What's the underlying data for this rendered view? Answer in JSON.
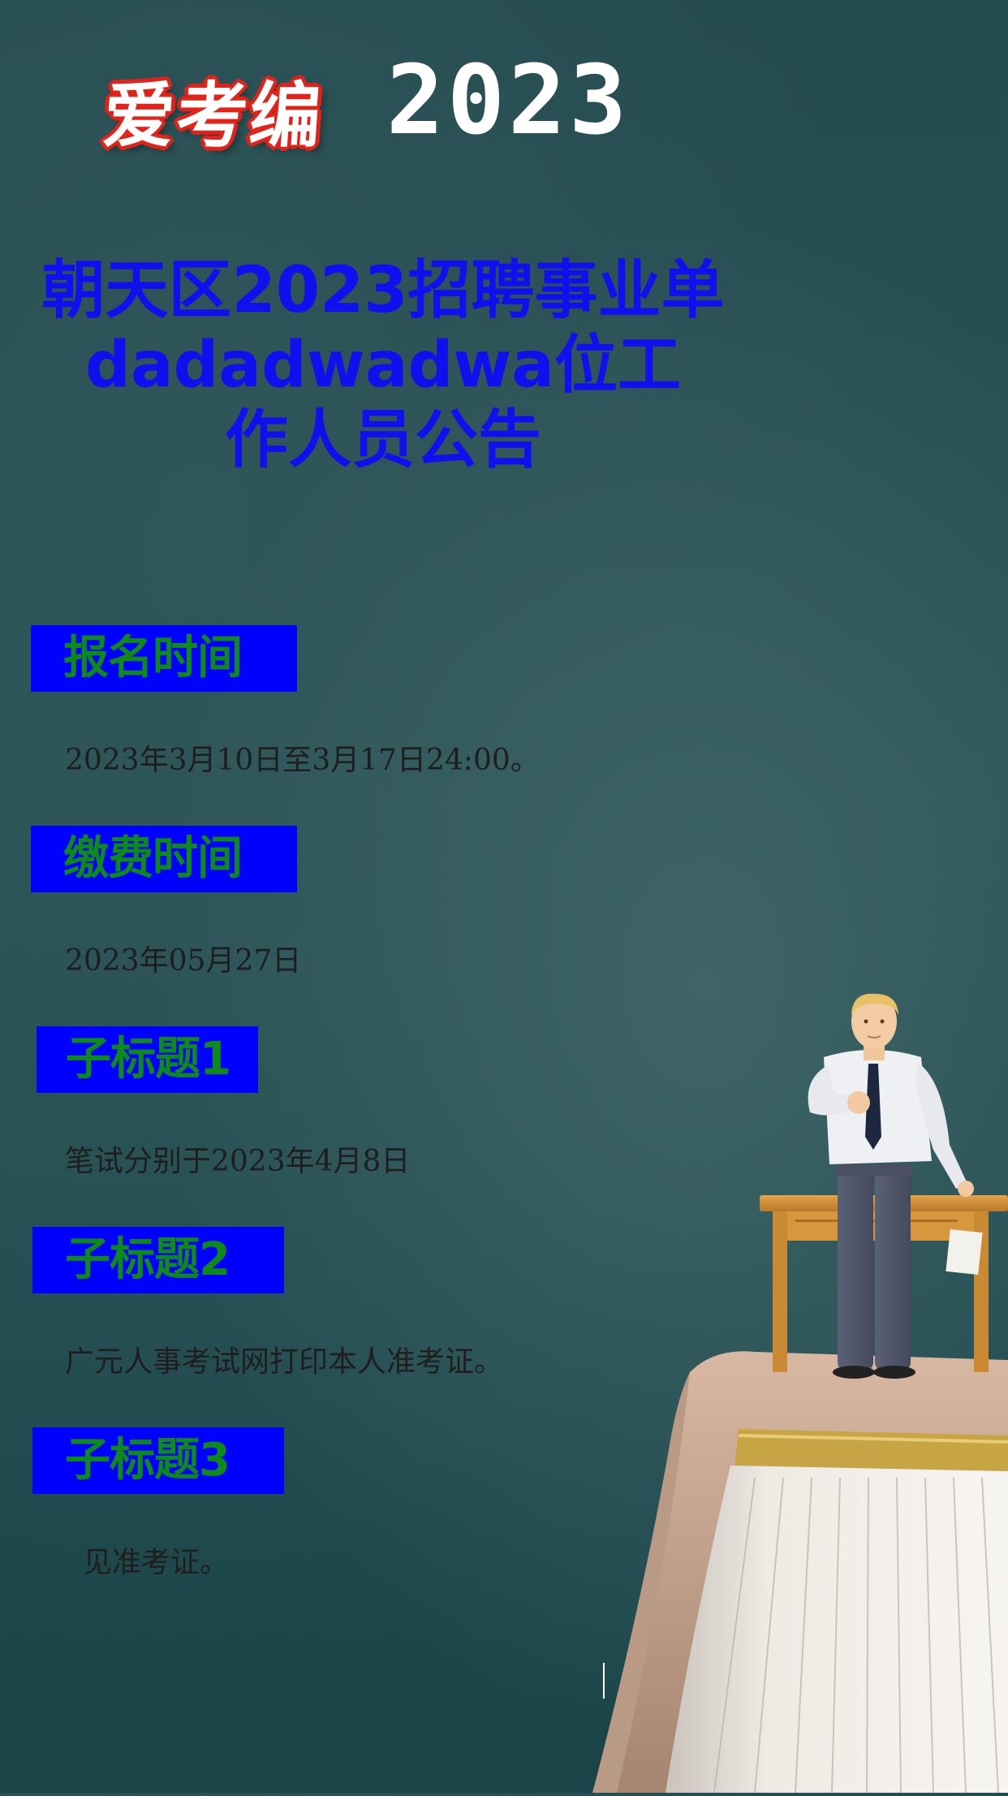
{
  "header": {
    "brand": "爱考编",
    "year": "2023"
  },
  "title": {
    "line1": "朝天区2023招聘事业单",
    "line2": "dadadwadwa位工",
    "line3": "作人员公告"
  },
  "sections": [
    {
      "label": "报名时间",
      "body": "2023年3月10日至3月17日24:00。"
    },
    {
      "label": "缴费时间",
      "body": "2023年05月27日"
    },
    {
      "label": "子标题1",
      "body": "笔试分别于2023年4月8日"
    },
    {
      "label": "子标题2",
      "body": "广元人事考试网打印本人准考证。"
    },
    {
      "label": "子标题3",
      "body": "见准考证。"
    }
  ],
  "colors": {
    "label_bg": "#0000ff",
    "label_text": "#0d8a17",
    "title_text": "#1010ee",
    "body_text": "#1e1e1e",
    "brand_outline": "#e2231a"
  },
  "icons": {
    "illustration": "teacher-figurine-on-book-illustration"
  }
}
